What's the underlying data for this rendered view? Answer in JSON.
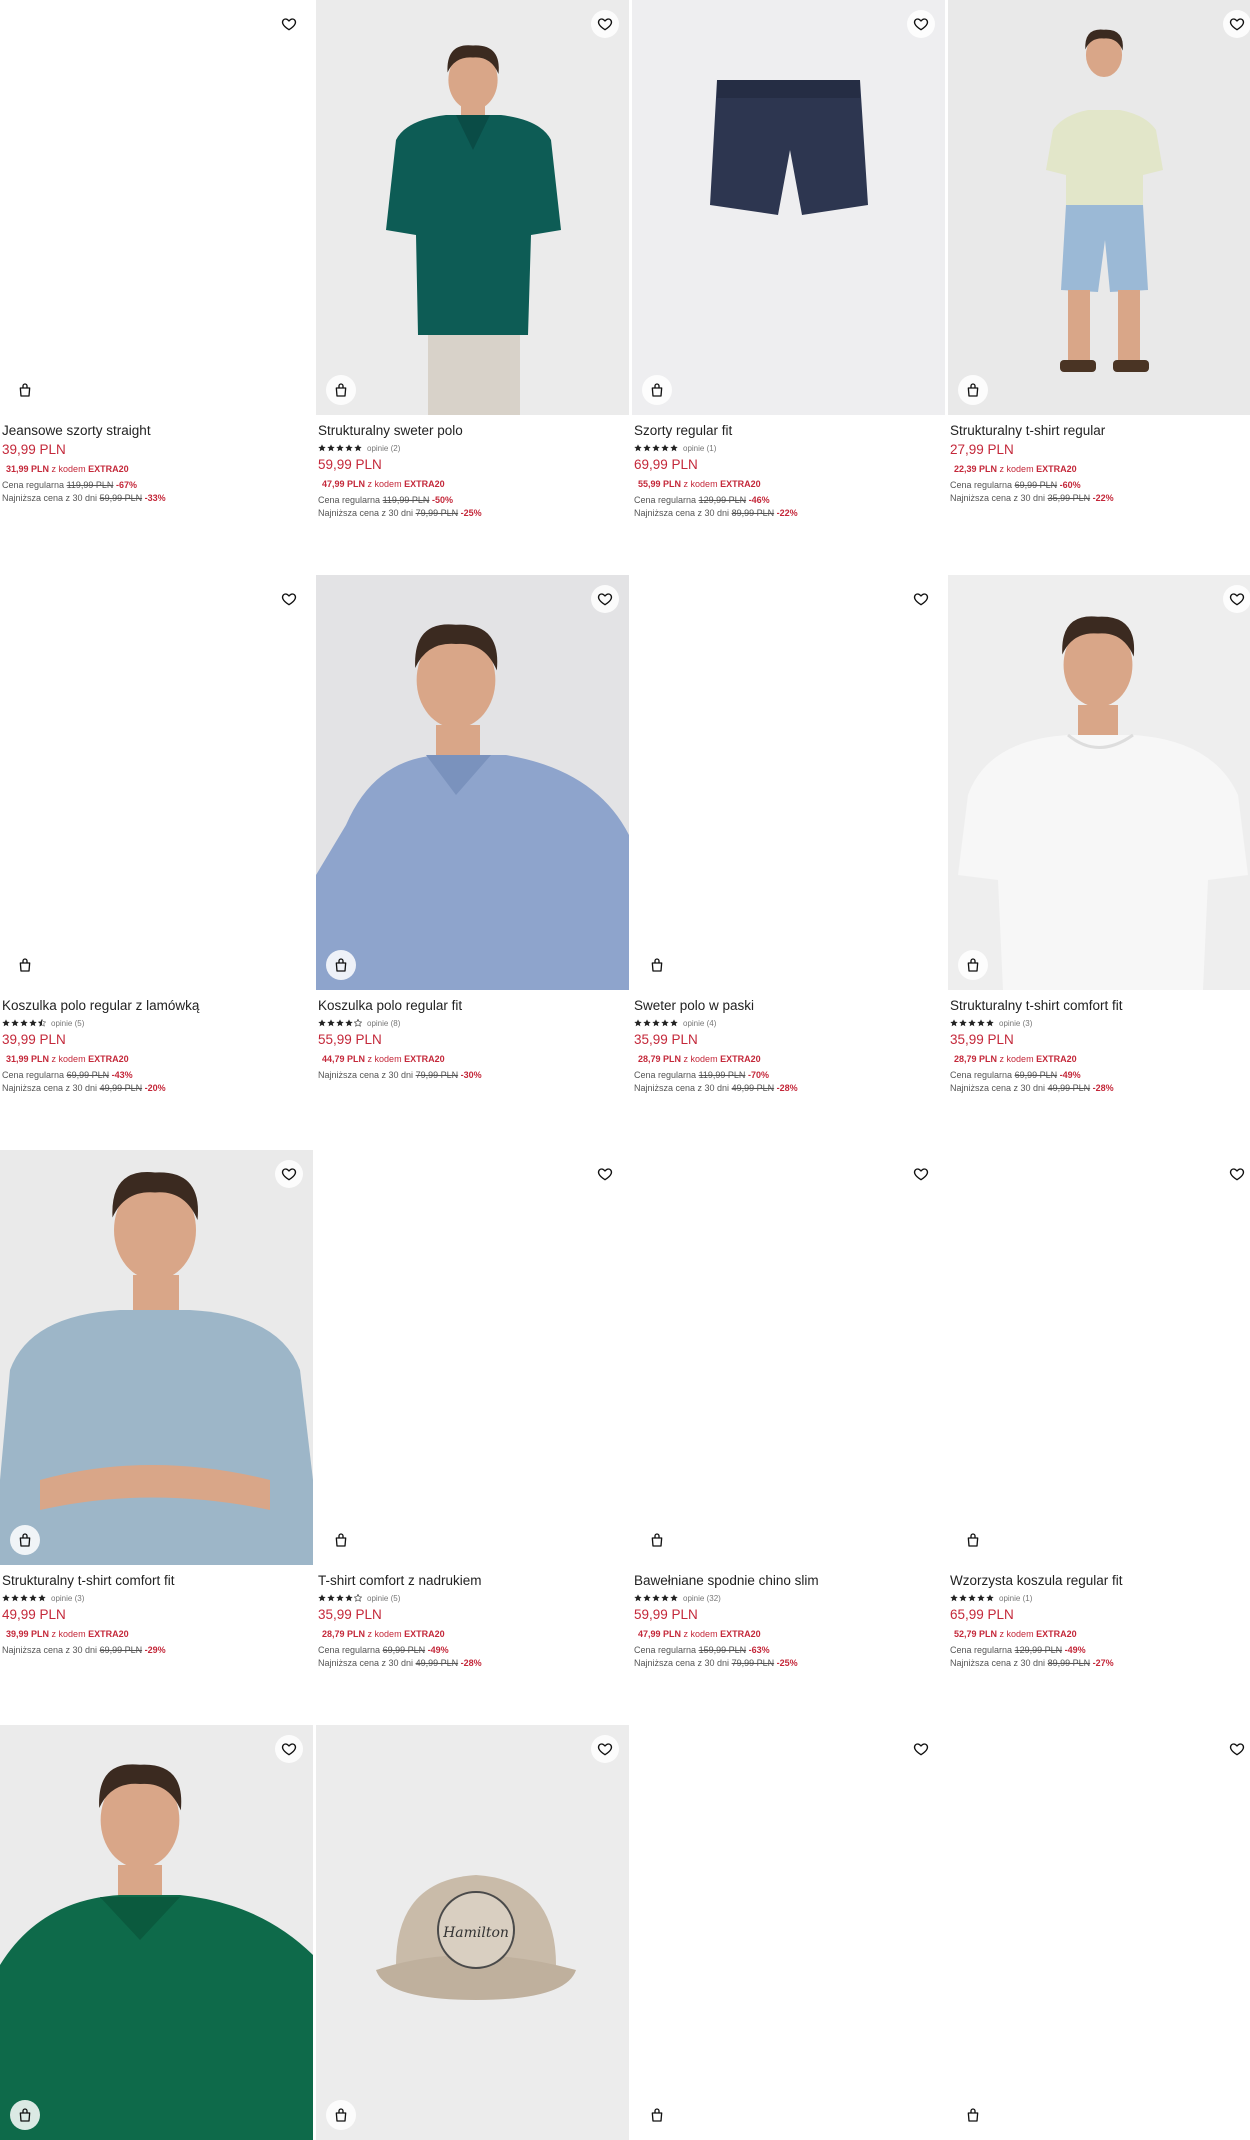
{
  "products": [
    {
      "name": "Jeansowe szorty straight",
      "price": "39,99 PLN",
      "promo_price": "31,99 PLN",
      "promo_text": "z kodem",
      "promo_code": "EXTRA20",
      "regular_label": "Cena regularna",
      "regular_price": "119,99 PLN",
      "regular_discount": "-67%",
      "lowest_label": "Najniższa cena z 30 dni",
      "lowest_price": "59,99 PLN",
      "lowest_discount": "-33%",
      "rating": 0,
      "reviews": "",
      "image": "blank"
    },
    {
      "name": "Strukturalny sweter polo",
      "price": "59,99 PLN",
      "promo_price": "47,99 PLN",
      "promo_text": "z kodem",
      "promo_code": "EXTRA20",
      "regular_label": "Cena regularna",
      "regular_price": "119,99 PLN",
      "regular_discount": "-50%",
      "lowest_label": "Najniższa cena z 30 dni",
      "lowest_price": "79,99 PLN",
      "lowest_discount": "-25%",
      "rating": 5,
      "reviews": "opinie (2)",
      "image": "teal-polo"
    },
    {
      "name": "Szorty regular fit",
      "price": "69,99 PLN",
      "promo_price": "55,99 PLN",
      "promo_text": "z kodem",
      "promo_code": "EXTRA20",
      "regular_label": "Cena regularna",
      "regular_price": "129,99 PLN",
      "regular_discount": "-46%",
      "lowest_label": "Najniższa cena z 30 dni",
      "lowest_price": "89,99 PLN",
      "lowest_discount": "-22%",
      "rating": 5,
      "reviews": "opinie (1)",
      "image": "navy-shorts"
    },
    {
      "name": "Strukturalny t-shirt regular",
      "price": "27,99 PLN",
      "promo_price": "22,39 PLN",
      "promo_text": "z kodem",
      "promo_code": "EXTRA20",
      "regular_label": "Cena regularna",
      "regular_price": "69,99 PLN",
      "regular_discount": "-60%",
      "lowest_label": "Najniższa cena z 30 dni",
      "lowest_price": "35,99 PLN",
      "lowest_discount": "-22%",
      "rating": 0,
      "reviews": "",
      "image": "mint-tee"
    },
    {
      "name": "Koszulka polo regular z lamówką",
      "price": "39,99 PLN",
      "promo_price": "31,99 PLN",
      "promo_text": "z kodem",
      "promo_code": "EXTRA20",
      "regular_label": "Cena regularna",
      "regular_price": "69,99 PLN",
      "regular_discount": "-43%",
      "lowest_label": "Najniższa cena z 30 dni",
      "lowest_price": "49,99 PLN",
      "lowest_discount": "-20%",
      "rating": 4.5,
      "reviews": "opinie (5)",
      "image": "blank"
    },
    {
      "name": "Koszulka polo regular fit",
      "price": "55,99 PLN",
      "promo_price": "44,79 PLN",
      "promo_text": "z kodem",
      "promo_code": "EXTRA20",
      "regular_label": "",
      "regular_price": "",
      "regular_discount": "",
      "lowest_label": "Najniższa cena z 30 dni",
      "lowest_price": "79,99 PLN",
      "lowest_discount": "-30%",
      "rating": 4,
      "reviews": "opinie (8)",
      "image": "blue-polo"
    },
    {
      "name": "Sweter polo w paski",
      "price": "35,99 PLN",
      "promo_price": "28,79 PLN",
      "promo_text": "z kodem",
      "promo_code": "EXTRA20",
      "regular_label": "Cena regularna",
      "regular_price": "119,99 PLN",
      "regular_discount": "-70%",
      "lowest_label": "Najniższa cena z 30 dni",
      "lowest_price": "49,99 PLN",
      "lowest_discount": "-28%",
      "rating": 5,
      "reviews": "opinie (4)",
      "image": "blank"
    },
    {
      "name": "Strukturalny t-shirt comfort fit",
      "price": "35,99 PLN",
      "promo_price": "28,79 PLN",
      "promo_text": "z kodem",
      "promo_code": "EXTRA20",
      "regular_label": "Cena regularna",
      "regular_price": "69,99 PLN",
      "regular_discount": "-49%",
      "lowest_label": "Najniższa cena z 30 dni",
      "lowest_price": "49,99 PLN",
      "lowest_discount": "-28%",
      "rating": 5,
      "reviews": "opinie (3)",
      "image": "white-tee"
    },
    {
      "name": "Strukturalny t-shirt comfort fit",
      "price": "49,99 PLN",
      "promo_price": "39,99 PLN",
      "promo_text": "z kodem",
      "promo_code": "EXTRA20",
      "regular_label": "",
      "regular_price": "",
      "regular_discount": "",
      "lowest_label": "Najniższa cena z 30 dni",
      "lowest_price": "69,99 PLN",
      "lowest_discount": "-29%",
      "rating": 5,
      "reviews": "opinie (3)",
      "image": "lightblue-tee"
    },
    {
      "name": "T-shirt comfort z nadrukiem",
      "price": "35,99 PLN",
      "promo_price": "28,79 PLN",
      "promo_text": "z kodem",
      "promo_code": "EXTRA20",
      "regular_label": "Cena regularna",
      "regular_price": "69,99 PLN",
      "regular_discount": "-49%",
      "lowest_label": "Najniższa cena z 30 dni",
      "lowest_price": "49,99 PLN",
      "lowest_discount": "-28%",
      "rating": 4,
      "reviews": "opinie (5)",
      "image": "blank"
    },
    {
      "name": "Bawełniane spodnie chino slim",
      "price": "59,99 PLN",
      "promo_price": "47,99 PLN",
      "promo_text": "z kodem",
      "promo_code": "EXTRA20",
      "regular_label": "Cena regularna",
      "regular_price": "159,99 PLN",
      "regular_discount": "-63%",
      "lowest_label": "Najniższa cena z 30 dni",
      "lowest_price": "79,99 PLN",
      "lowest_discount": "-25%",
      "rating": 5,
      "reviews": "opinie (32)",
      "image": "blank"
    },
    {
      "name": "Wzorzysta koszula regular fit",
      "price": "65,99 PLN",
      "promo_price": "52,79 PLN",
      "promo_text": "z kodem",
      "promo_code": "EXTRA20",
      "regular_label": "Cena regularna",
      "regular_price": "129,99 PLN",
      "regular_discount": "-49%",
      "lowest_label": "Najniższa cena z 30 dni",
      "lowest_price": "89,99 PLN",
      "lowest_discount": "-27%",
      "rating": 5,
      "reviews": "opinie (1)",
      "image": "blank"
    },
    {
      "name": "",
      "price": "",
      "rating": 0,
      "reviews": "",
      "image": "green-polo"
    },
    {
      "name": "",
      "price": "",
      "rating": 0,
      "reviews": "",
      "image": "cap",
      "cap_text": "Hamilton"
    },
    {
      "name": "",
      "price": "",
      "rating": 0,
      "reviews": "",
      "image": "blank"
    },
    {
      "name": "",
      "price": "",
      "rating": 0,
      "reviews": "",
      "image": "blank"
    }
  ],
  "icons": {
    "favorite": "heart-icon",
    "add_to_cart": "shopping-bag-icon",
    "rating": "star-icon"
  },
  "colors": {
    "price_red": "#c4283a",
    "text": "#222222",
    "muted": "#555555"
  }
}
